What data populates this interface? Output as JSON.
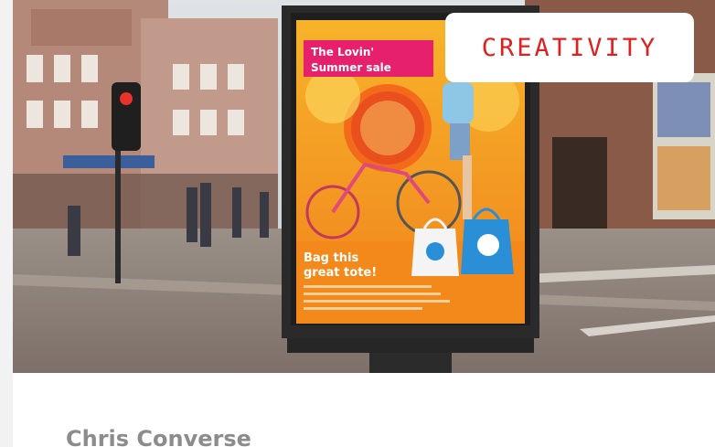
{
  "card": {
    "category_tag": "CREATIVITY",
    "author": "Chris Converse"
  },
  "poster": {
    "headline_line1": "The Lovin'",
    "headline_line2": "Summer sale",
    "offer_line1": "Bag this",
    "offer_line2": "great tote!"
  },
  "colors": {
    "tag_text": "#e02020",
    "poster_orange": "#f39a1e",
    "poster_pink": "#e6206b",
    "poster_blue": "#2a8fd6"
  }
}
